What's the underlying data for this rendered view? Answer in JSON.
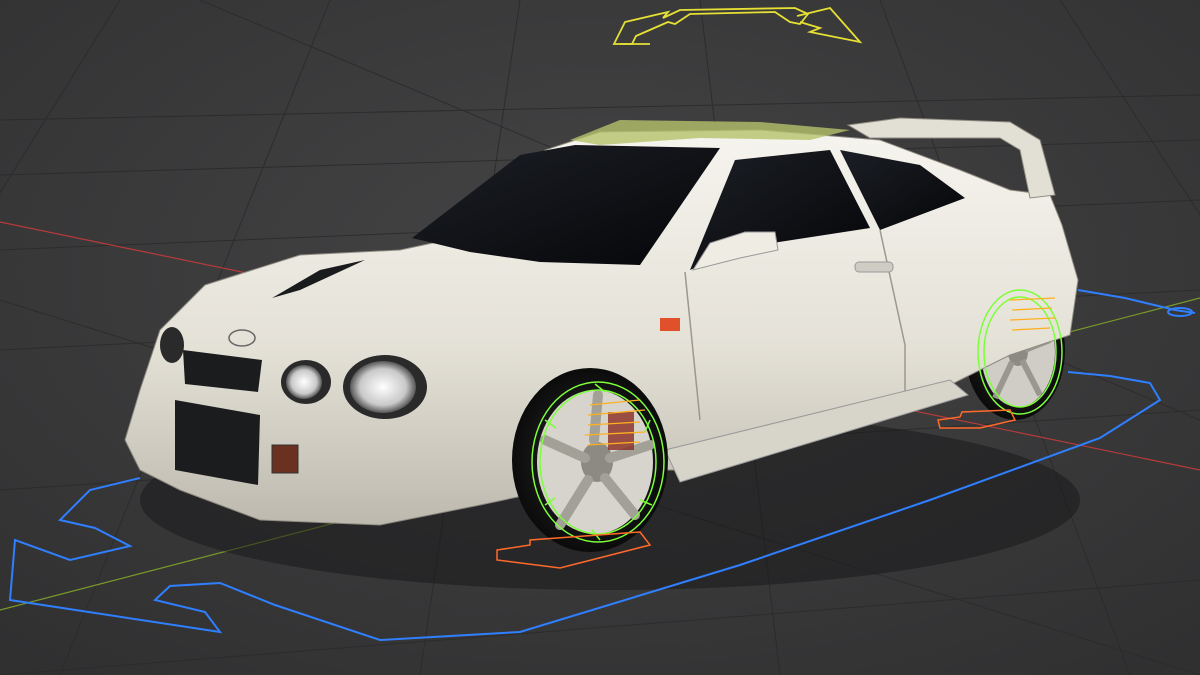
{
  "viewport": {
    "background_color": "#3a3a3b",
    "grid_color": "#2d2d2e",
    "axis_x_color": "#b83a3a",
    "axis_y_color": "#7a9a2a",
    "car_body_color": "#e9e6dd",
    "rig_colors": {
      "root": "#2f7fff",
      "body": "#e6e035",
      "wheel": "#7dff3a",
      "suspension": "#ffb020",
      "contact": "#ff6a2a"
    },
    "objects": [
      {
        "name": "car-body",
        "icon": "car-mesh"
      },
      {
        "name": "root-control",
        "icon": "arrow-rig"
      },
      {
        "name": "body-control",
        "icon": "arrow-rig"
      },
      {
        "name": "front-wheel-control",
        "icon": "wheel-ring"
      },
      {
        "name": "rear-wheel-control",
        "icon": "wheel-ring"
      }
    ]
  }
}
